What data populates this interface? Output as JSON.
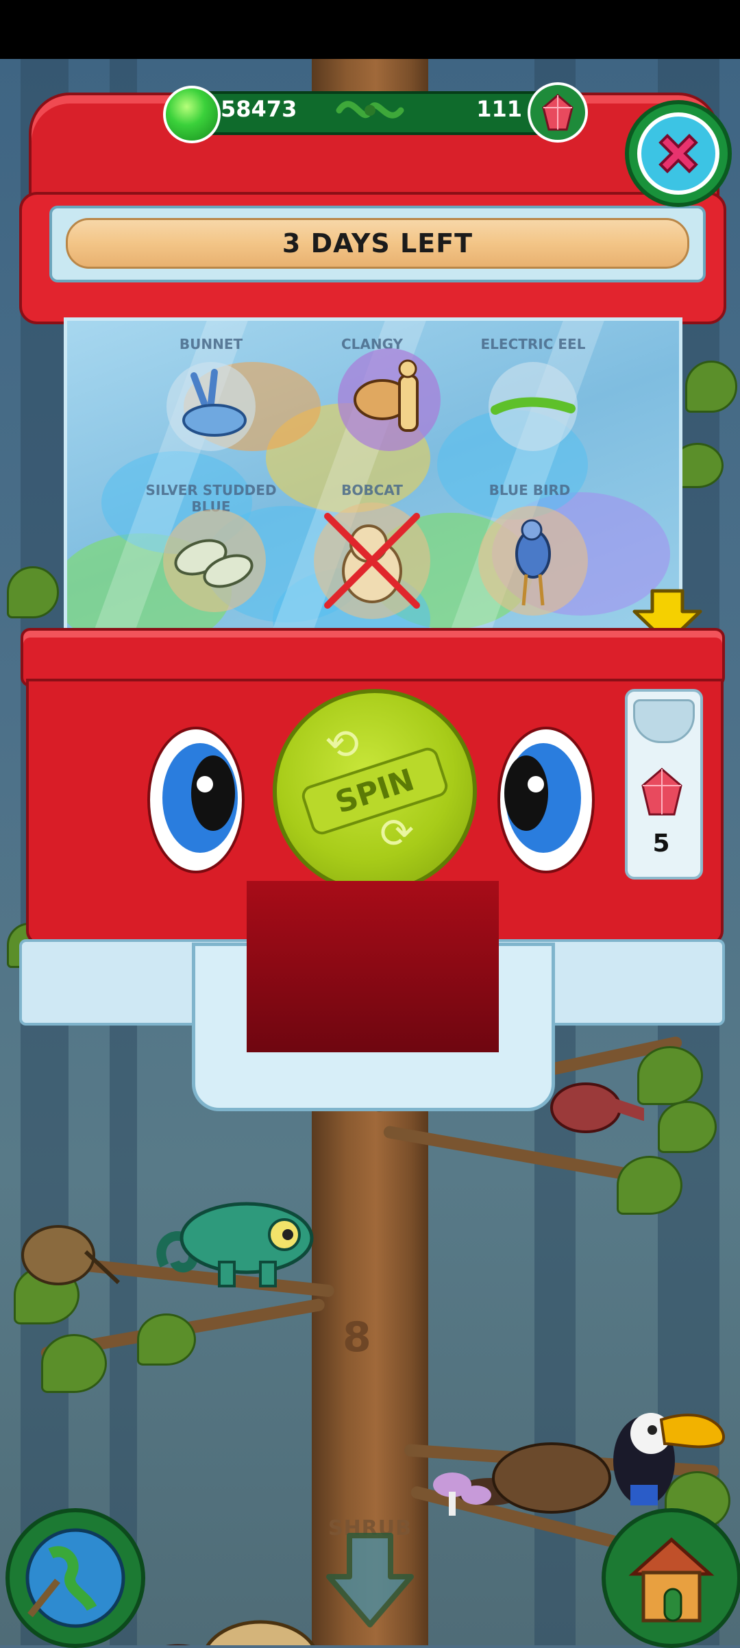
{
  "currency": {
    "coins": "58473",
    "gems": "111"
  },
  "banner": {
    "text": "3 DAYS LEFT"
  },
  "prizes": [
    {
      "name": "BUNNET",
      "collected": false,
      "color": "#cfe3ef"
    },
    {
      "name": "CLANGY",
      "collected": false,
      "color": "#a97bd8"
    },
    {
      "name": "ELECTRIC EEL",
      "collected": false,
      "color": "#cfe3ef"
    },
    {
      "name": "SILVER STUDDED BLUE",
      "collected": false,
      "color": "#e7c08a"
    },
    {
      "name": "BOBCAT",
      "collected": true,
      "color": "#e7c08a"
    },
    {
      "name": "BLUE BIRD",
      "collected": false,
      "color": "#e7c08a"
    }
  ],
  "spin": {
    "label": "SPIN"
  },
  "spin_cost": {
    "value": "5",
    "icon": "crystal-icon"
  },
  "tree": {
    "level_label": "SHRUB",
    "stage_mark": "8"
  },
  "nav": {
    "left_icon": "globe-icon",
    "center_icon": "down-arrow-icon",
    "right_icon": "house-icon"
  },
  "colors": {
    "machine_red": "#d91d27",
    "spin_green": "#a8cc19",
    "close_pink": "#e8336e",
    "hint_yellow": "#f5d000"
  }
}
